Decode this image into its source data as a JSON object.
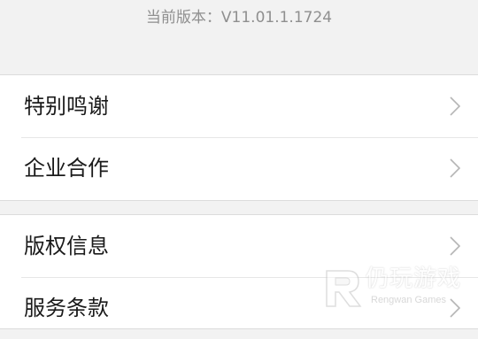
{
  "version": {
    "text": "当前版本：V11.01.1.1724"
  },
  "groups": [
    {
      "items": [
        {
          "label": "特别鸣谢",
          "icon": "chevron-right-icon"
        },
        {
          "label": "企业合作",
          "icon": "chevron-right-icon"
        }
      ]
    },
    {
      "items": [
        {
          "label": "版权信息",
          "icon": "chevron-right-icon"
        },
        {
          "label": "服务条款",
          "icon": "chevron-right-icon"
        }
      ]
    }
  ],
  "watermark": {
    "title": "仍玩游戏",
    "subtitle": "Rengwan Games"
  },
  "colors": {
    "background": "#f2f2f2",
    "row_background": "#ffffff",
    "text": "#1a1a1a",
    "muted_text": "#8f8f8f",
    "chevron": "#b5b5b5"
  }
}
